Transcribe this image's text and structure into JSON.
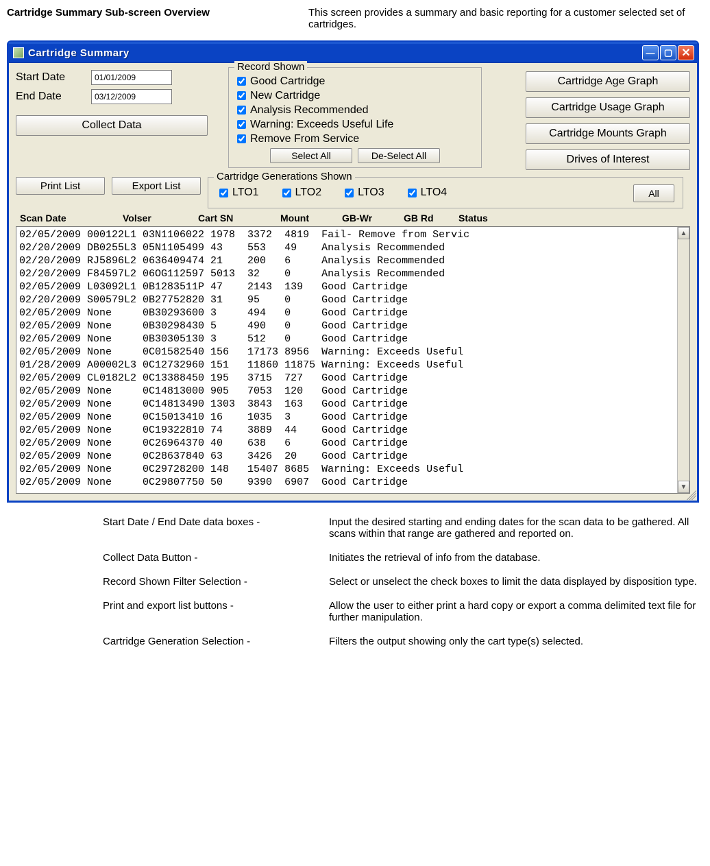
{
  "doc": {
    "heading": "Cartridge Summary Sub-screen Overview",
    "intro": "This screen provides a summary and basic reporting for a customer selected set of cartridges."
  },
  "window": {
    "title": "Cartridge Summary",
    "start_date_label": "Start Date",
    "end_date_label": "End Date",
    "start_date_value": "01/01/2009",
    "end_date_value": "03/12/2009",
    "collect_btn": "Collect Data",
    "record_shown_title": "Record Shown",
    "record_shown": {
      "good": "Good Cartridge",
      "new": "New Cartridge",
      "analysis": "Analysis Recommended",
      "warning": "Warning: Exceeds Useful Life",
      "remove": "Remove From Service"
    },
    "select_all_btn": "Select All",
    "deselect_all_btn": "De-Select All",
    "right_buttons": {
      "age": "Cartridge Age Graph",
      "usage": "Cartridge Usage Graph",
      "mounts": "Cartridge Mounts Graph",
      "drives": "Drives of Interest"
    },
    "print_btn": "Print List",
    "export_btn": "Export List",
    "gen_title": "Cartridge Generations Shown",
    "gens": {
      "lto1": "LTO1",
      "lto2": "LTO2",
      "lto3": "LTO3",
      "lto4": "LTO4"
    },
    "all_btn": "All",
    "columns": {
      "scan_date": "Scan Date",
      "volser": "Volser",
      "cart_sn": "Cart SN",
      "mount": "Mount",
      "gb_wr": "GB-Wr",
      "gb_rd": "GB Rd",
      "status": "Status"
    },
    "rows": [
      [
        "02/05/2009",
        "000122L1",
        "03N1106022",
        "1978",
        "3372",
        "4819",
        "Fail- Remove from Servic"
      ],
      [
        "02/20/2009",
        "DB0255L3",
        "05N1105499",
        "43",
        "553",
        "49",
        "Analysis Recommended"
      ],
      [
        "02/20/2009",
        "RJ5896L2",
        "0636409474",
        "21",
        "200",
        "6",
        "Analysis Recommended"
      ],
      [
        "02/20/2009",
        "F84597L2",
        "06OG112597",
        "5013",
        "32",
        "0",
        "Analysis Recommended"
      ],
      [
        "02/05/2009",
        "L03092L1",
        "0B1283511P",
        "47",
        "2143",
        "139",
        "Good Cartridge"
      ],
      [
        "02/20/2009",
        "S00579L2",
        "0B27752820",
        "31",
        "95",
        "0",
        "Good Cartridge"
      ],
      [
        "02/05/2009",
        "None",
        "0B30293600",
        "3",
        "494",
        "0",
        "Good Cartridge"
      ],
      [
        "02/05/2009",
        "None",
        "0B30298430",
        "5",
        "490",
        "0",
        "Good Cartridge"
      ],
      [
        "02/05/2009",
        "None",
        "0B30305130",
        "3",
        "512",
        "0",
        "Good Cartridge"
      ],
      [
        "02/05/2009",
        "None",
        "0C01582540",
        "156",
        "17173",
        "8956",
        "Warning: Exceeds Useful"
      ],
      [
        "01/28/2009",
        "A00002L3",
        "0C12732960",
        "151",
        "11860",
        "11875",
        "Warning: Exceeds Useful"
      ],
      [
        "02/05/2009",
        "CL0182L2",
        "0C13388450",
        "195",
        "3715",
        "727",
        "Good Cartridge"
      ],
      [
        "02/05/2009",
        "None",
        "0C14813000",
        "905",
        "7053",
        "120",
        "Good Cartridge"
      ],
      [
        "02/05/2009",
        "None",
        "0C14813490",
        "1303",
        "3843",
        "163",
        "Good Cartridge"
      ],
      [
        "02/05/2009",
        "None",
        "0C15013410",
        "16",
        "1035",
        "3",
        "Good Cartridge"
      ],
      [
        "02/05/2009",
        "None",
        "0C19322810",
        "74",
        "3889",
        "44",
        "Good Cartridge"
      ],
      [
        "02/05/2009",
        "None",
        "0C26964370",
        "40",
        "638",
        "6",
        "Good Cartridge"
      ],
      [
        "02/05/2009",
        "None",
        "0C28637840",
        "63",
        "3426",
        "20",
        "Good Cartridge"
      ],
      [
        "02/05/2009",
        "None",
        "0C29728200",
        "148",
        "15407",
        "8685",
        "Warning: Exceeds Useful"
      ],
      [
        "02/05/2009",
        "None",
        "0C29807750",
        "50",
        "9390",
        "6907",
        "Good Cartridge"
      ]
    ]
  },
  "desc": [
    {
      "l": "Start Date / End Date data boxes -",
      "r": "Input the desired starting and ending dates for the scan data to be gathered.  All scans within that range are gathered and reported on."
    },
    {
      "l": "Collect Data Button -",
      "r": "Initiates the retrieval of info from the database."
    },
    {
      "l": "Record Shown Filter Selection -",
      "r": "Select or unselect the check boxes to limit the data displayed by disposition type."
    },
    {
      "l": "Print and export list buttons -",
      "r": "Allow the user to either print a hard copy or export a comma delimited text file for further manipulation."
    },
    {
      "l": "Cartridge Generation Selection -",
      "r": "Filters the output showing only the cart type(s) selected."
    }
  ]
}
